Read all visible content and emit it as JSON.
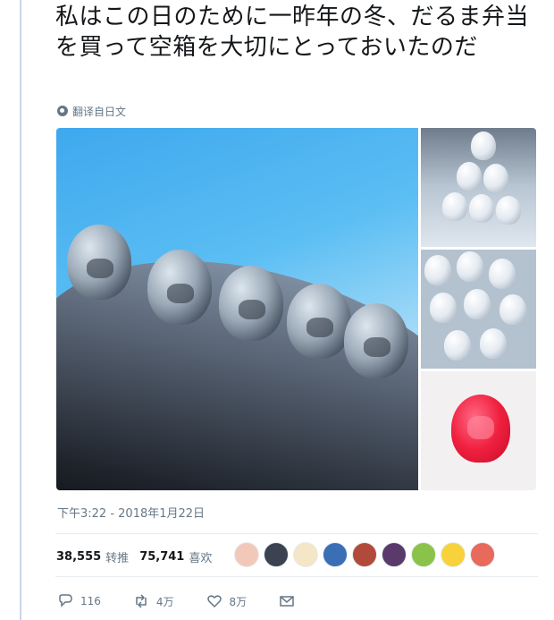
{
  "tweet": {
    "text": "私はこの日のために一昨年の冬、だるま弁当を買って空箱を大切にとっておいたのだ",
    "translate_label": "翻译自日文",
    "timestamp": "下午3:22 - 2018年1月22日"
  },
  "stats": {
    "retweets_count": "38,555",
    "retweets_label": "转推",
    "likes_count": "75,741",
    "likes_label": "喜欢",
    "liker_avatar_colors": [
      "#f2c9b8",
      "#3b4250",
      "#f4e6c6",
      "#3a6fb5",
      "#b24a3c",
      "#5a3a6b",
      "#8bc34a",
      "#f7d23a",
      "#e86a5c"
    ]
  },
  "actions": {
    "reply_count": "116",
    "retweet_count": "4万",
    "like_count": "8万"
  },
  "icons": {
    "translate": "globe-icon",
    "reply": "reply-bubble-icon",
    "retweet": "retweet-arrows-icon",
    "like": "heart-icon",
    "dm": "envelope-icon"
  },
  "colors": {
    "text": "#14171a",
    "muted": "#657786",
    "divider": "#e6ecf0"
  }
}
